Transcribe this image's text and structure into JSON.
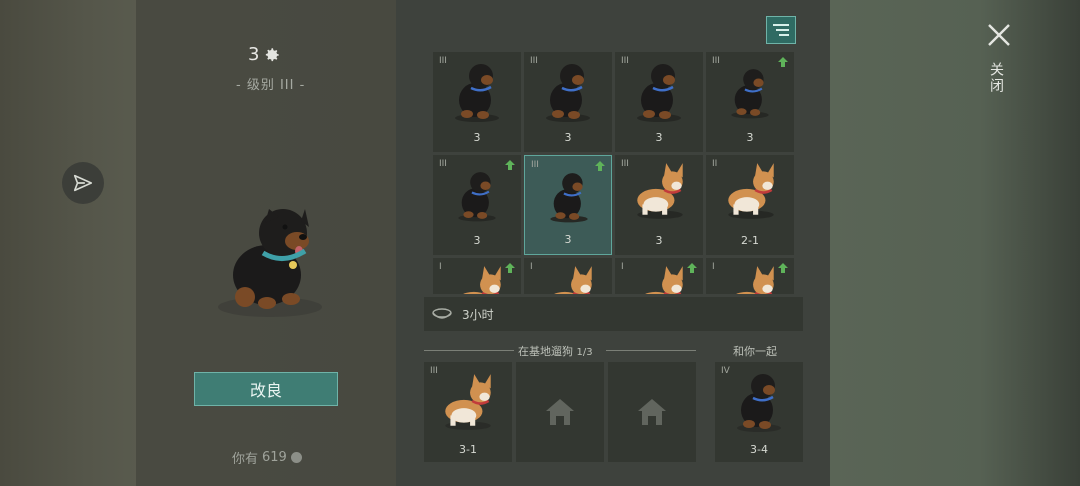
{
  "pet": {
    "level": "3",
    "level_subtitle": "- 级别 III -",
    "improve_label": "改良",
    "currency_prefix": "你有",
    "currency_amount": "619"
  },
  "grid": {
    "tiles": [
      {
        "tier": "III",
        "value": "3",
        "breed": "rottweiler",
        "upgradable": false,
        "selected": false
      },
      {
        "tier": "III",
        "value": "3",
        "breed": "rottweiler",
        "upgradable": false,
        "selected": false
      },
      {
        "tier": "III",
        "value": "3",
        "breed": "rottweiler",
        "upgradable": false,
        "selected": false
      },
      {
        "tier": "III",
        "value": "3",
        "breed": "rottweiler-pup",
        "upgradable": true,
        "selected": false
      },
      {
        "tier": "III",
        "value": "3",
        "breed": "rottweiler-pup",
        "upgradable": true,
        "selected": false
      },
      {
        "tier": "III",
        "value": "3",
        "breed": "rottweiler-pup",
        "upgradable": true,
        "selected": true
      },
      {
        "tier": "III",
        "value": "3",
        "breed": "corgi",
        "upgradable": false,
        "selected": false
      },
      {
        "tier": "II",
        "value": "2-1",
        "breed": "corgi",
        "upgradable": false,
        "selected": false
      },
      {
        "tier": "I",
        "value": "",
        "breed": "corgi-pup",
        "upgradable": true,
        "selected": false
      },
      {
        "tier": "I",
        "value": "",
        "breed": "corgi-pup",
        "upgradable": false,
        "selected": false
      },
      {
        "tier": "I",
        "value": "",
        "breed": "corgi-pup",
        "upgradable": true,
        "selected": false
      },
      {
        "tier": "I",
        "value": "",
        "breed": "corgi-pup",
        "upgradable": true,
        "selected": false
      }
    ]
  },
  "timer": {
    "text": "3小时",
    "icon": "food-bowl-icon"
  },
  "walk": {
    "label": "在基地遛狗",
    "count": "1/3",
    "slots": [
      {
        "tier": "III",
        "value": "3-1",
        "breed": "corgi"
      },
      {
        "tier": "",
        "value": "",
        "breed": "empty"
      },
      {
        "tier": "",
        "value": "",
        "breed": "empty"
      }
    ]
  },
  "companion": {
    "label": "和你一起",
    "tier": "IV",
    "value": "3-4",
    "breed": "rottweiler"
  },
  "close_label": "关闭",
  "colors": {
    "accent": "#3f7d74",
    "accent_border": "#6fb3a8",
    "upgrade_arrow": "#5fb35a",
    "tile_bg": "#333731"
  }
}
